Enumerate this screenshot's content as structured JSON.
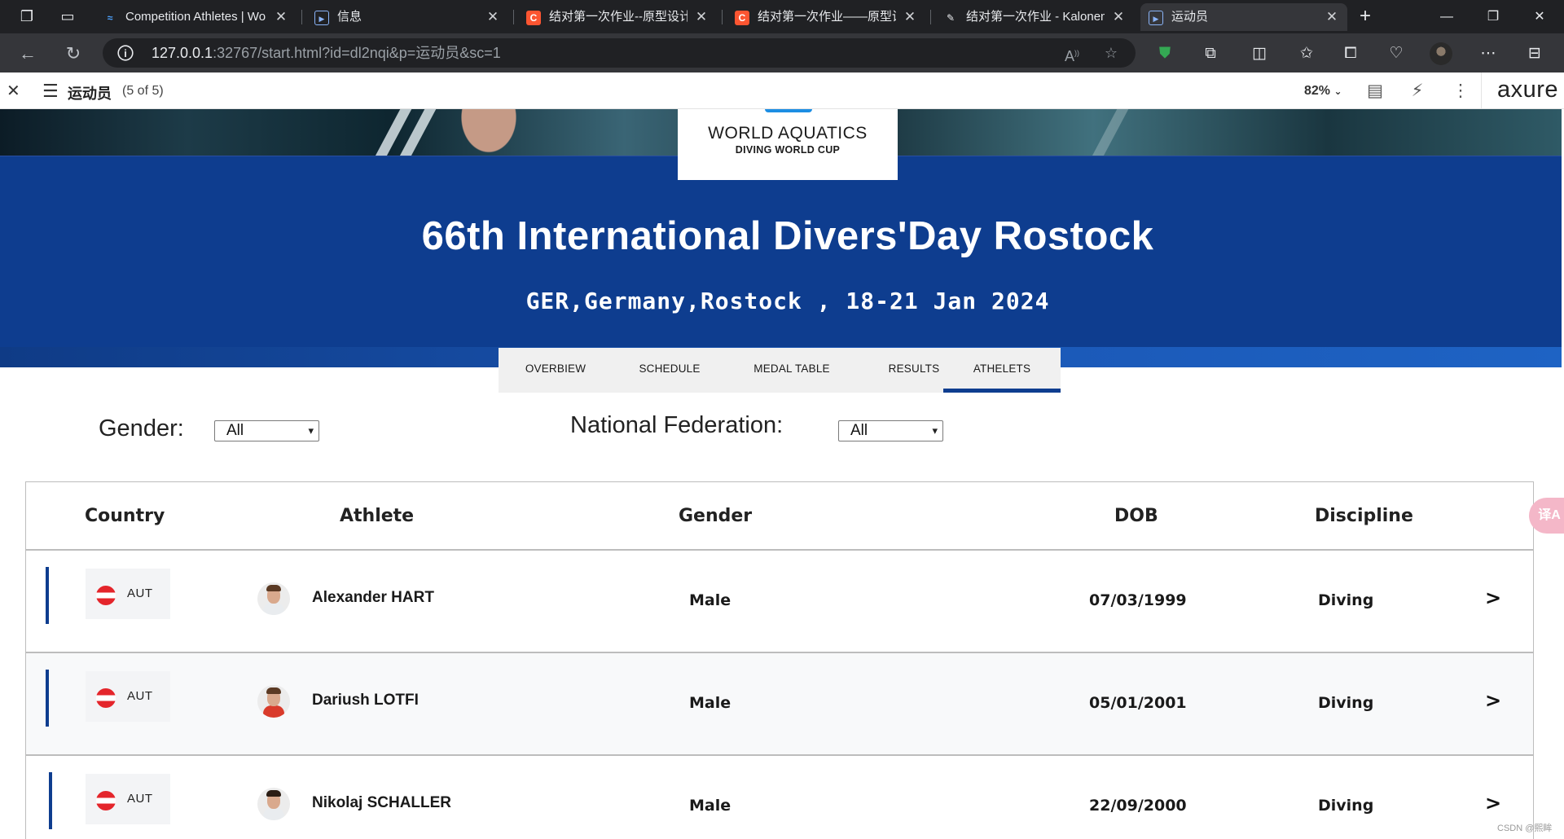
{
  "browser": {
    "tabs": [
      {
        "title": "Competition Athletes | Wo",
        "active": false,
        "favicon": "world-aquatics-favicon"
      },
      {
        "title": "信息",
        "active": false,
        "favicon": "axure-favicon"
      },
      {
        "title": "结对第一次作业--原型设计",
        "active": false,
        "favicon": "csdn-favicon"
      },
      {
        "title": "结对第一次作业——原型设",
        "active": false,
        "favicon": "csdn-favicon"
      },
      {
        "title": "结对第一次作业 - Kalonem",
        "active": false,
        "favicon": "cnblogs-favicon"
      },
      {
        "title": "运动员",
        "active": true,
        "favicon": "axure-favicon"
      }
    ],
    "url_host": "127.0.0.1",
    "url_rest": ":32767/start.html?id=dl2nqi&p=运动员&sc=1"
  },
  "axure": {
    "page_name": "运动员",
    "page_count": "(5 of 5)",
    "zoom": "82%",
    "logo": "axure"
  },
  "hero": {
    "logo_title": "WORLD AQUATICS",
    "logo_subtitle": "DIVING WORLD CUP",
    "event_title": "66th International Divers'Day Rostock",
    "event_subtitle": "GER,Germany,Rostock , 18-21 Jan 2024"
  },
  "nav_tabs": [
    {
      "label": "OVERBIEW",
      "active": false
    },
    {
      "label": "SCHEDULE",
      "active": false
    },
    {
      "label": "MEDAL TABLE",
      "active": false
    },
    {
      "label": "RESULTS",
      "active": false
    },
    {
      "label": "ATHELETS",
      "active": true
    }
  ],
  "filters": {
    "gender_label": "Gender:",
    "gender_value": "All",
    "federation_label": "National Federation:",
    "federation_value": "All"
  },
  "table": {
    "headers": [
      "Country",
      "Athlete",
      "Gender",
      "DOB",
      "Discipline"
    ],
    "rows": [
      {
        "country": "AUT",
        "athlete": "Alexander HART",
        "gender": "Male",
        "dob": "07/03/1999",
        "discipline": "Diving",
        "action": ">"
      },
      {
        "country": "AUT",
        "athlete": "Dariush LOTFI",
        "gender": "Male",
        "dob": "05/01/2001",
        "discipline": "Diving",
        "action": ">"
      },
      {
        "country": "AUT",
        "athlete": "Nikolaj SCHALLER",
        "gender": "Male",
        "dob": "22/09/2000",
        "discipline": "Diving",
        "action": ">"
      }
    ]
  },
  "widgets": {
    "translate_label": "译A",
    "watermark": "CSDN @熙眸"
  },
  "colors": {
    "brand_blue": "#0e3d8f",
    "flag_red": "#e4252b"
  }
}
